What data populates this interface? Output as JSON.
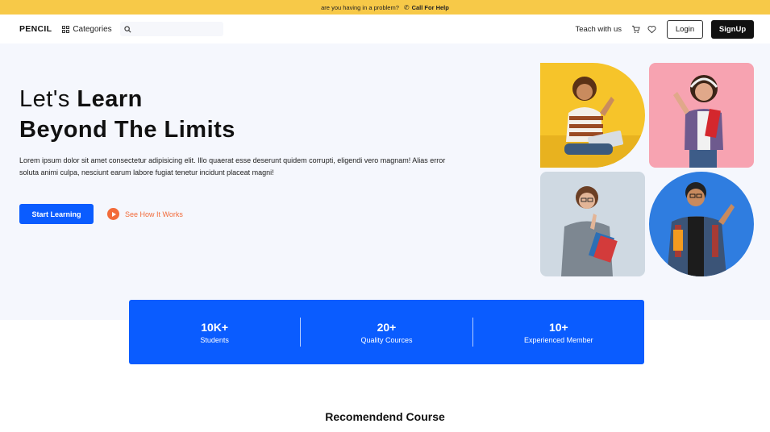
{
  "topbar": {
    "question": "are you having in a problem?",
    "help_label": "Call For Help"
  },
  "nav": {
    "logo": "PENCIL",
    "categories_label": "Categories",
    "search_placeholder": "",
    "teach_label": "Teach with us",
    "login_label": "Login",
    "signup_label": "SignUp"
  },
  "hero": {
    "title_line1_light": "Let's ",
    "title_line1_bold": "Learn",
    "title_line2": "Beyond The Limits",
    "description": "Lorem ipsum dolor sit amet consectetur adipisicing elit. Illo quaerat esse deserunt quidem corrupti, eligendi vero magnam! Alias error soluta animi culpa, nesciunt earum labore fugiat tenetur incidunt placeat magni!",
    "start_label": "Start Learning",
    "see_label": "See How It Works"
  },
  "stats": [
    {
      "value": "10K+",
      "label": "Students"
    },
    {
      "value": "20+",
      "label": "Quality Cources"
    },
    {
      "value": "10+",
      "label": "Experienced Member"
    }
  ],
  "section_title": "Recomendend Course",
  "colors": {
    "accent": "#0a5cff",
    "topbar": "#f7c948",
    "cta_secondary": "#f26b3a",
    "hero_bg": "#f5f7fd"
  }
}
